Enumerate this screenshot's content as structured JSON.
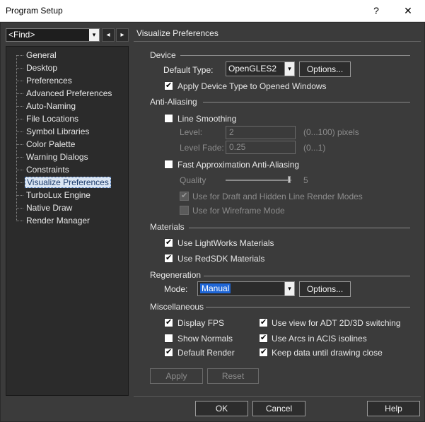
{
  "window": {
    "title": "Program Setup",
    "help_glyph": "?",
    "close_glyph": "✕"
  },
  "left": {
    "find_value": "<Find>",
    "combo_arrow": "▾",
    "prev_arrow": "◂",
    "next_arrow": "▸",
    "tree_items": [
      "General",
      "Desktop",
      "Preferences",
      "Advanced Preferences",
      "Auto-Naming",
      "File Locations",
      "Symbol Libraries",
      "Color Palette",
      "Warning Dialogs",
      "Constraints",
      "Visualize Preferences",
      "TurboLux Engine",
      "Native Draw",
      "Render Manager"
    ],
    "selected_index": 10
  },
  "page": {
    "title": "Visualize Preferences",
    "device": {
      "group": "Device",
      "default_type_label": "Default Type:",
      "default_type_value": "OpenGLES2",
      "options_label": "Options...",
      "apply_type_label": "Apply Device Type to Opened Windows",
      "apply_type_checked": true
    },
    "anti_aliasing": {
      "group": "Anti-Aliasing",
      "line_smoothing_label": "Line Smoothing",
      "line_smoothing_checked": false,
      "level_label": "Level:",
      "level_value": "2",
      "level_range": "(0...100) pixels",
      "level_fade_label": "Level Fade:",
      "level_fade_value": "0.25",
      "level_fade_range": "(0...1)",
      "fast_label": "Fast Approximation Anti-Aliasing",
      "fast_checked": false,
      "quality_label": "Quality",
      "quality_value": "5",
      "quality_fraction": 1.0,
      "draft_label": "Use for Draft and Hidden Line Render Modes",
      "draft_checked": true,
      "wireframe_label": "Use for Wireframe Mode",
      "wireframe_checked": false
    },
    "materials": {
      "group": "Materials",
      "lightworks_label": "Use LightWorks Materials",
      "lightworks_checked": true,
      "redsdk_label": "Use RedSDK Materials",
      "redsdk_checked": true
    },
    "regeneration": {
      "group": "Regeneration",
      "mode_label": "Mode:",
      "mode_value": "Manual",
      "options_label": "Options..."
    },
    "misc": {
      "group": "Miscellaneous",
      "display_fps_label": "Display FPS",
      "display_fps_checked": true,
      "show_normals_label": "Show Normals",
      "show_normals_checked": false,
      "default_render_label": "Default Render",
      "default_render_checked": true,
      "adt_label": "Use view for ADT 2D/3D switching",
      "adt_checked": true,
      "arcs_label": "Use Arcs in ACIS isolines",
      "arcs_checked": true,
      "keep_label": "Keep data until drawing close",
      "keep_checked": true
    },
    "apply_label": "Apply",
    "reset_label": "Reset"
  },
  "footer": {
    "ok_label": "OK",
    "cancel_label": "Cancel",
    "help_label": "Help"
  }
}
